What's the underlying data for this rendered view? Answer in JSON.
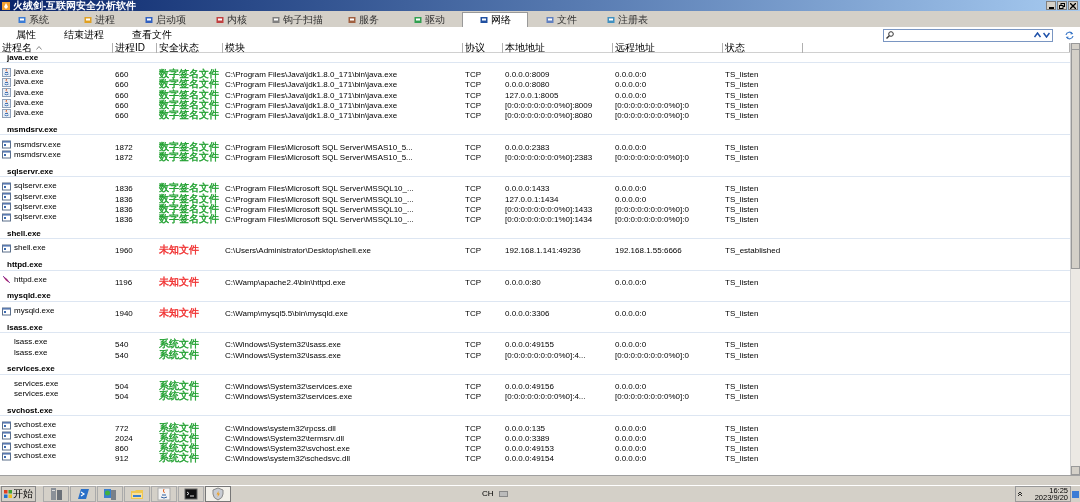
{
  "window": {
    "title": "火绒剑-互联网安全分析软件"
  },
  "tabs": [
    {
      "label": "系统",
      "selected": false
    },
    {
      "label": "进程",
      "selected": false
    },
    {
      "label": "启动项",
      "selected": false
    },
    {
      "label": "内核",
      "selected": false
    },
    {
      "label": "钩子扫描",
      "selected": false
    },
    {
      "label": "服务",
      "selected": false
    },
    {
      "label": "驱动",
      "selected": false
    },
    {
      "label": "网络",
      "selected": true
    },
    {
      "label": "文件",
      "selected": false
    },
    {
      "label": "注册表",
      "selected": false
    }
  ],
  "toolbar": [
    "属性",
    "结束进程",
    "查看文件"
  ],
  "columns": [
    "进程名",
    "进程ID",
    "安全状态",
    "模块",
    "协议",
    "本地地址",
    "远程地址",
    "状态"
  ],
  "groups": [
    {
      "name": "java.exe",
      "rows": [
        {
          "kind": "java",
          "process": "java.exe",
          "pid": "660",
          "security": "数字签名文件",
          "color": "#20a030",
          "module": "C:\\Program Files\\Java\\jdk1.8.0_171\\bin\\java.exe",
          "protocol": "TCP",
          "local": "0.0.0.0:8009",
          "remote": "0.0.0.0:0",
          "state": "TS_listen"
        },
        {
          "kind": "java",
          "process": "java.exe",
          "pid": "660",
          "security": "数字签名文件",
          "color": "#20a030",
          "module": "C:\\Program Files\\Java\\jdk1.8.0_171\\bin\\java.exe",
          "protocol": "TCP",
          "local": "0.0.0.0:8080",
          "remote": "0.0.0.0:0",
          "state": "TS_listen"
        },
        {
          "kind": "java",
          "process": "java.exe",
          "pid": "660",
          "security": "数字签名文件",
          "color": "#20a030",
          "module": "C:\\Program Files\\Java\\jdk1.8.0_171\\bin\\java.exe",
          "protocol": "TCP",
          "local": "127.0.0.1:8005",
          "remote": "0.0.0.0:0",
          "state": "TS_listen"
        },
        {
          "kind": "java",
          "process": "java.exe",
          "pid": "660",
          "security": "数字签名文件",
          "color": "#20a030",
          "module": "C:\\Program Files\\Java\\jdk1.8.0_171\\bin\\java.exe",
          "protocol": "TCP",
          "local": "[0:0:0:0:0:0:0:0%0]:8009",
          "remote": "[0:0:0:0:0:0:0:0%0]:0",
          "state": "TS_listen"
        },
        {
          "kind": "java",
          "process": "java.exe",
          "pid": "660",
          "security": "数字签名文件",
          "color": "#20a030",
          "module": "C:\\Program Files\\Java\\jdk1.8.0_171\\bin\\java.exe",
          "protocol": "TCP",
          "local": "[0:0:0:0:0:0:0:0%0]:8080",
          "remote": "[0:0:0:0:0:0:0:0%0]:0",
          "state": "TS_listen"
        }
      ]
    },
    {
      "name": "msmdsrv.exe",
      "rows": [
        {
          "kind": "exe",
          "process": "msmdsrv.exe",
          "pid": "1872",
          "security": "数字签名文件",
          "color": "#20a030",
          "module": "C:\\Program Files\\Microsoft SQL Server\\MSAS10_5...",
          "protocol": "TCP",
          "local": "0.0.0.0:2383",
          "remote": "0.0.0.0:0",
          "state": "TS_listen"
        },
        {
          "kind": "exe",
          "process": "msmdsrv.exe",
          "pid": "1872",
          "security": "数字签名文件",
          "color": "#20a030",
          "module": "C:\\Program Files\\Microsoft SQL Server\\MSAS10_5...",
          "protocol": "TCP",
          "local": "[0:0:0:0:0:0:0:0%0]:2383",
          "remote": "[0:0:0:0:0:0:0:0%0]:0",
          "state": "TS_listen"
        }
      ]
    },
    {
      "name": "sqlservr.exe",
      "rows": [
        {
          "kind": "exe",
          "process": "sqlservr.exe",
          "pid": "1836",
          "security": "数字签名文件",
          "color": "#20a030",
          "module": "C:\\Program Files\\Microsoft SQL Server\\MSSQL10_...",
          "protocol": "TCP",
          "local": "0.0.0.0:1433",
          "remote": "0.0.0.0:0",
          "state": "TS_listen"
        },
        {
          "kind": "exe",
          "process": "sqlservr.exe",
          "pid": "1836",
          "security": "数字签名文件",
          "color": "#20a030",
          "module": "C:\\Program Files\\Microsoft SQL Server\\MSSQL10_...",
          "protocol": "TCP",
          "local": "127.0.0.1:1434",
          "remote": "0.0.0.0:0",
          "state": "TS_listen"
        },
        {
          "kind": "exe",
          "process": "sqlservr.exe",
          "pid": "1836",
          "security": "数字签名文件",
          "color": "#20a030",
          "module": "C:\\Program Files\\Microsoft SQL Server\\MSSQL10_...",
          "protocol": "TCP",
          "local": "[0:0:0:0:0:0:0:0%0]:1433",
          "remote": "[0:0:0:0:0:0:0:0%0]:0",
          "state": "TS_listen"
        },
        {
          "kind": "exe",
          "process": "sqlservr.exe",
          "pid": "1836",
          "security": "数字签名文件",
          "color": "#20a030",
          "module": "C:\\Program Files\\Microsoft SQL Server\\MSSQL10_...",
          "protocol": "TCP",
          "local": "[0:0:0:0:0:0:0:1%0]:1434",
          "remote": "[0:0:0:0:0:0:0:0%0]:0",
          "state": "TS_listen"
        }
      ]
    },
    {
      "name": "shell.exe",
      "rows": [
        {
          "kind": "exe",
          "process": "shell.exe",
          "pid": "1960",
          "security": "未知文件",
          "color": "#f03030",
          "module": "C:\\Users\\Administrator\\Desktop\\shell.exe",
          "protocol": "TCP",
          "local": "192.168.1.141:49236",
          "remote": "192.168.1.55:6666",
          "state": "TS_established"
        }
      ]
    },
    {
      "name": "httpd.exe",
      "rows": [
        {
          "kind": "feather",
          "process": "httpd.exe",
          "pid": "1196",
          "security": "未知文件",
          "color": "#f03030",
          "module": "C:\\Wamp\\apache2.4\\bin\\httpd.exe",
          "protocol": "TCP",
          "local": "0.0.0.0:80",
          "remote": "0.0.0.0:0",
          "state": "TS_listen"
        }
      ]
    },
    {
      "name": "mysqld.exe",
      "rows": [
        {
          "kind": "exe",
          "process": "mysqld.exe",
          "pid": "1940",
          "security": "未知文件",
          "color": "#f03030",
          "module": "C:\\Wamp\\mysql5.5\\bin\\mysqld.exe",
          "protocol": "TCP",
          "local": "0.0.0.0:3306",
          "remote": "0.0.0.0:0",
          "state": "TS_listen"
        }
      ]
    },
    {
      "name": "lsass.exe",
      "rows": [
        {
          "kind": "plain",
          "process": "lsass.exe",
          "pid": "540",
          "security": "系统文件",
          "color": "#20a030",
          "module": "C:\\Windows\\System32\\lsass.exe",
          "protocol": "TCP",
          "local": "0.0.0.0:49155",
          "remote": "0.0.0.0:0",
          "state": "TS_listen"
        },
        {
          "kind": "plain",
          "process": "lsass.exe",
          "pid": "540",
          "security": "系统文件",
          "color": "#20a030",
          "module": "C:\\Windows\\System32\\lsass.exe",
          "protocol": "TCP",
          "local": "[0:0:0:0:0:0:0:0%0]:4...",
          "remote": "[0:0:0:0:0:0:0:0%0]:0",
          "state": "TS_listen"
        }
      ]
    },
    {
      "name": "services.exe",
      "rows": [
        {
          "kind": "plain",
          "process": "services.exe",
          "pid": "504",
          "security": "系统文件",
          "color": "#20a030",
          "module": "C:\\Windows\\System32\\services.exe",
          "protocol": "TCP",
          "local": "0.0.0.0:49156",
          "remote": "0.0.0.0:0",
          "state": "TS_listen"
        },
        {
          "kind": "plain",
          "process": "services.exe",
          "pid": "504",
          "security": "系统文件",
          "color": "#20a030",
          "module": "C:\\Windows\\System32\\services.exe",
          "protocol": "TCP",
          "local": "[0:0:0:0:0:0:0:0%0]:4...",
          "remote": "[0:0:0:0:0:0:0:0%0]:0",
          "state": "TS_listen"
        }
      ]
    },
    {
      "name": "svchost.exe",
      "rows": [
        {
          "kind": "exe",
          "process": "svchost.exe",
          "pid": "772",
          "security": "系统文件",
          "color": "#20a030",
          "module": "C:\\Windows\\system32\\rpcss.dll",
          "protocol": "TCP",
          "local": "0.0.0.0:135",
          "remote": "0.0.0.0:0",
          "state": "TS_listen"
        },
        {
          "kind": "exe",
          "process": "svchost.exe",
          "pid": "2024",
          "security": "系统文件",
          "color": "#20a030",
          "module": "C:\\Windows\\System32\\termsrv.dll",
          "protocol": "TCP",
          "local": "0.0.0.0:3389",
          "remote": "0.0.0.0:0",
          "state": "TS_listen"
        },
        {
          "kind": "exe",
          "process": "svchost.exe",
          "pid": "860",
          "security": "系统文件",
          "color": "#20a030",
          "module": "C:\\Windows\\System32\\svchost.exe",
          "protocol": "TCP",
          "local": "0.0.0.0:49153",
          "remote": "0.0.0.0:0",
          "state": "TS_listen"
        },
        {
          "kind": "exe",
          "process": "svchost.exe",
          "pid": "912",
          "security": "系统文件",
          "color": "#20a030",
          "module": "C:\\Windows\\system32\\schedsvc.dll",
          "protocol": "TCP",
          "local": "0.0.0.0:49154",
          "remote": "0.0.0.0:0",
          "state": "TS_listen"
        }
      ]
    }
  ],
  "taskbar": {
    "start": "开始",
    "apps": [
      {
        "kind": "server",
        "selected": false
      },
      {
        "kind": "shell",
        "selected": false
      },
      {
        "kind": "network",
        "selected": false
      },
      {
        "kind": "folder",
        "selected": false
      },
      {
        "kind": "java",
        "selected": false
      },
      {
        "kind": "console",
        "selected": false
      },
      {
        "kind": "shield",
        "selected": true
      }
    ],
    "language": "CH",
    "time": "16:25",
    "date": "2023/9/20"
  }
}
